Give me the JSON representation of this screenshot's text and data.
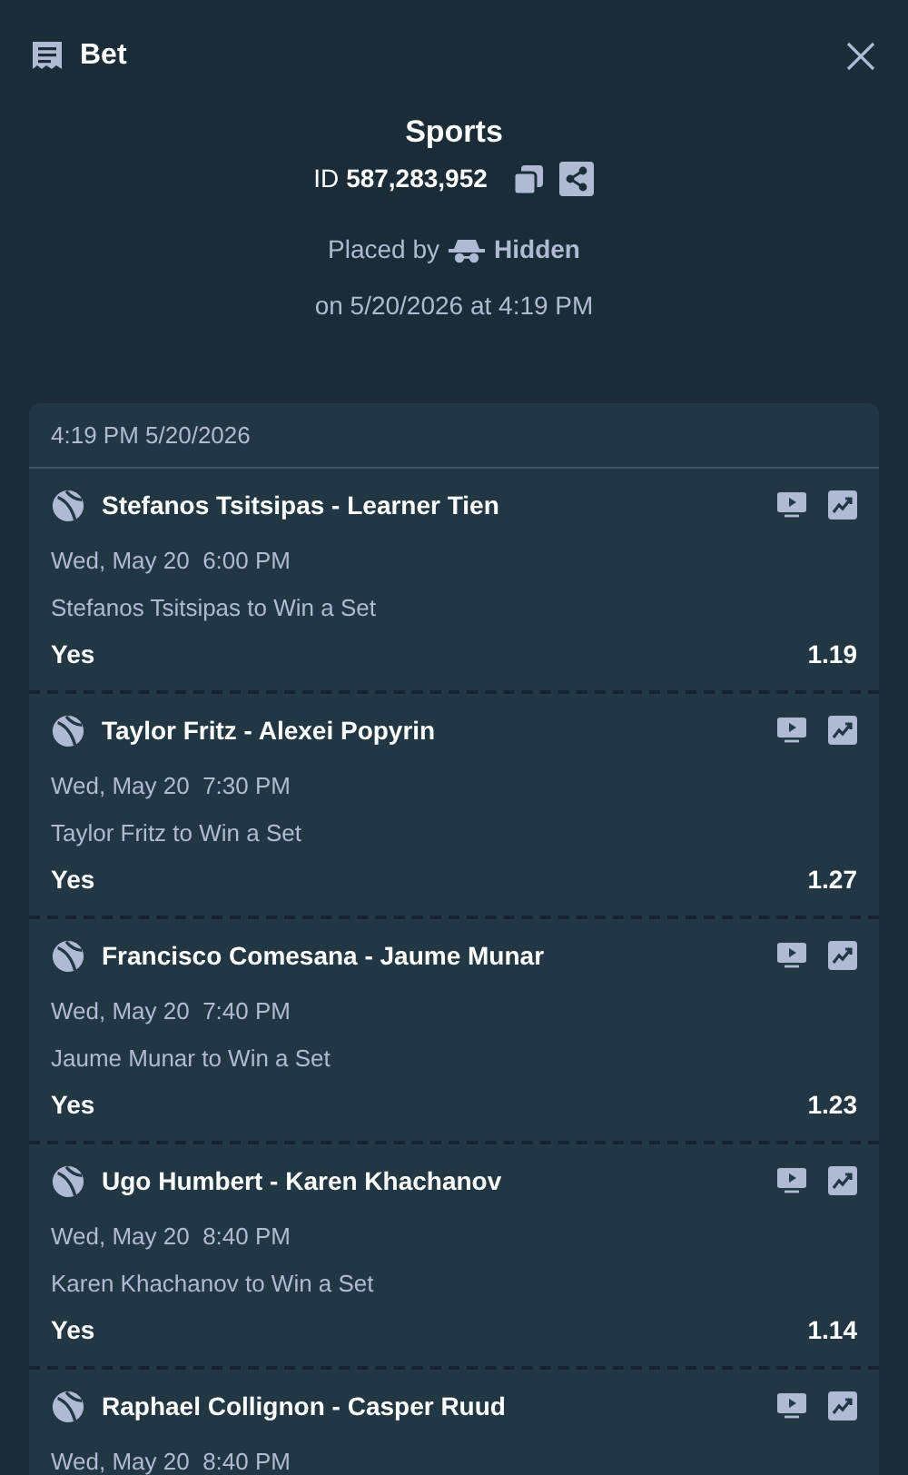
{
  "header": {
    "title": "Bet"
  },
  "summary": {
    "category": "Sports",
    "id_label": "ID",
    "id_value": "587,283,952",
    "placed_by_label": "Placed by",
    "placed_by": "Hidden",
    "placed_on": "on 5/20/2026 at 4:19 PM"
  },
  "slip": {
    "timestamp": "4:19 PM 5/20/2026",
    "legs": [
      {
        "match": "Stefanos Tsitsipas - Learner Tien",
        "time": "Wed, May 20  6:00 PM",
        "market": "Stefanos Tsitsipas to Win a Set",
        "outcome": "Yes",
        "odds": "1.19"
      },
      {
        "match": "Taylor Fritz - Alexei Popyrin",
        "time": "Wed, May 20  7:30 PM",
        "market": "Taylor Fritz to Win a Set",
        "outcome": "Yes",
        "odds": "1.27"
      },
      {
        "match": "Francisco Comesana - Jaume Munar",
        "time": "Wed, May 20  7:40 PM",
        "market": "Jaume Munar to Win a Set",
        "outcome": "Yes",
        "odds": "1.23"
      },
      {
        "match": "Ugo Humbert - Karen Khachanov",
        "time": "Wed, May 20  8:40 PM",
        "market": "Karen Khachanov to Win a Set",
        "outcome": "Yes",
        "odds": "1.14"
      },
      {
        "match": "Raphael Collignon - Casper Ruud",
        "time": "Wed, May 20  8:40 PM"
      }
    ]
  }
}
